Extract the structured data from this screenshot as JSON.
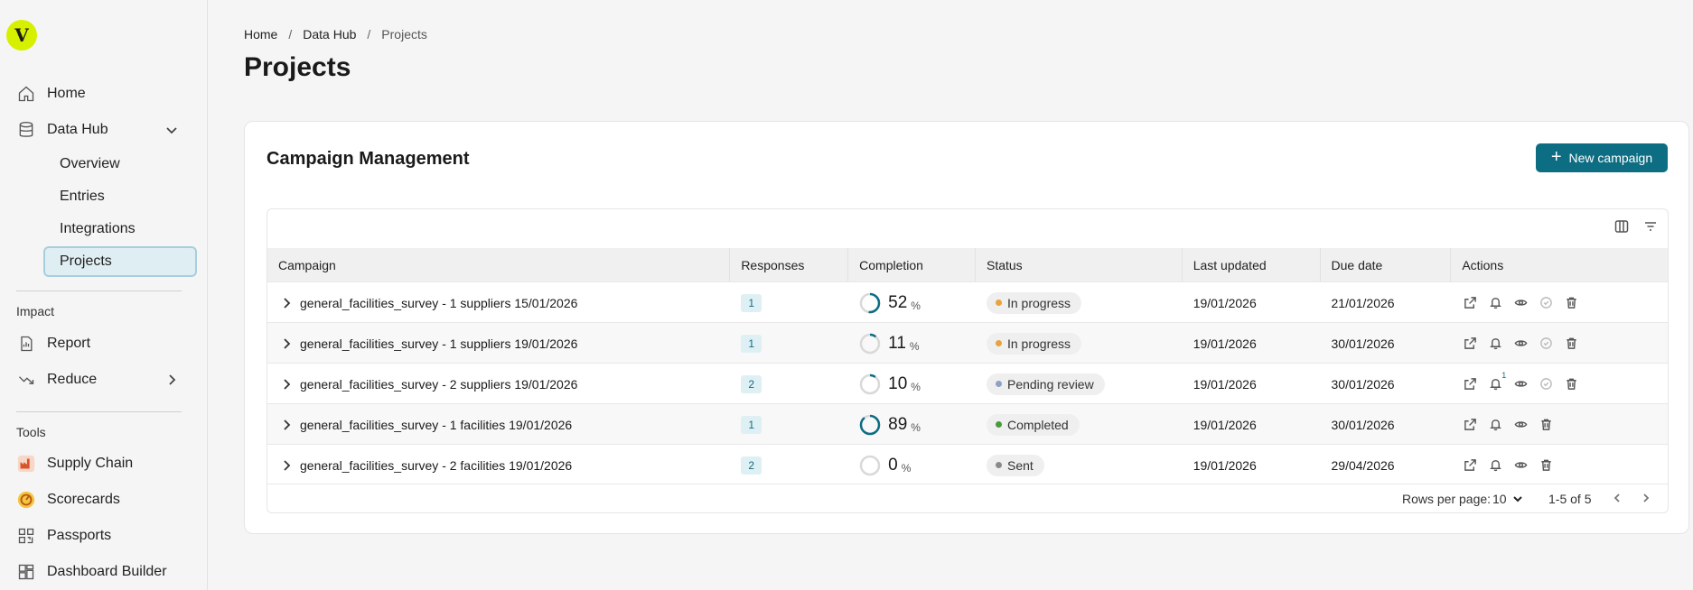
{
  "sidebar": {
    "logo_letter": "V",
    "home": "Home",
    "data_hub": "Data Hub",
    "data_hub_items": [
      "Overview",
      "Entries",
      "Integrations",
      "Projects"
    ],
    "impact_title": "Impact",
    "report": "Report",
    "reduce": "Reduce",
    "tools_title": "Tools",
    "tools": [
      "Supply Chain",
      "Scorecards",
      "Passports",
      "Dashboard Builder"
    ]
  },
  "breadcrumb": {
    "items": [
      "Home",
      "Data Hub",
      "Projects"
    ],
    "separator": "/"
  },
  "page_title": "Projects",
  "card": {
    "title": "Campaign Management",
    "new_button": "New campaign",
    "new_button_icon": "+"
  },
  "table": {
    "columns": [
      "Campaign",
      "Responses",
      "Completion",
      "Status",
      "Last updated",
      "Due date",
      "Actions"
    ],
    "rows": [
      {
        "campaign": "general_facilities_survey - 1 suppliers 15/01/2026",
        "responses": "1",
        "completion": 52,
        "completion_label": "52",
        "status": "In progress",
        "status_color": "#e8a33c",
        "last_updated": "19/01/2026",
        "due_date": "21/01/2026",
        "notif_count": "",
        "approve_enabled": false,
        "show_approve": true
      },
      {
        "campaign": "general_facilities_survey - 1 suppliers 19/01/2026",
        "responses": "1",
        "completion": 11,
        "completion_label": "11",
        "status": "In progress",
        "status_color": "#e8a33c",
        "last_updated": "19/01/2026",
        "due_date": "30/01/2026",
        "notif_count": "",
        "approve_enabled": false,
        "show_approve": true
      },
      {
        "campaign": "general_facilities_survey - 2 suppliers 19/01/2026",
        "responses": "2",
        "completion": 10,
        "completion_label": "10",
        "status": "Pending review",
        "status_color": "#8ea2c7",
        "last_updated": "19/01/2026",
        "due_date": "30/01/2026",
        "notif_count": "1",
        "approve_enabled": false,
        "show_approve": true
      },
      {
        "campaign": "general_facilities_survey - 1 facilities 19/01/2026",
        "responses": "1",
        "completion": 89,
        "completion_label": "89",
        "status": "Completed",
        "status_color": "#4a9a3a",
        "last_updated": "19/01/2026",
        "due_date": "30/01/2026",
        "notif_count": "",
        "approve_enabled": false,
        "show_approve": false
      },
      {
        "campaign": "general_facilities_survey - 2 facilities 19/01/2026",
        "responses": "2",
        "completion": 0,
        "completion_label": "0",
        "status": "Sent",
        "status_color": "#8a8a8a",
        "last_updated": "19/01/2026",
        "due_date": "29/04/2026",
        "notif_count": "",
        "approve_enabled": false,
        "show_approve": false
      }
    ],
    "percent_sign": "%"
  },
  "footer": {
    "rows_per_page_label": "Rows per page:",
    "rows_per_page_value": "10",
    "range": "1-5 of 5"
  },
  "colors": {
    "accent": "#0d6d82",
    "logo": "#d6f000"
  }
}
